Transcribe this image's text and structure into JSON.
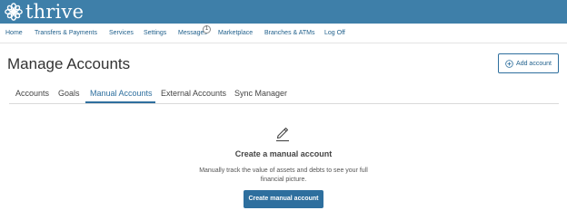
{
  "brand": {
    "name": "thrive",
    "logo_icon": "flower-mark-icon"
  },
  "nav": {
    "items": [
      {
        "label": "Home"
      },
      {
        "label": "Transfers & Payments"
      },
      {
        "label": "Services"
      },
      {
        "label": "Settings"
      },
      {
        "label": "Messages"
      },
      {
        "label": "Marketplace"
      },
      {
        "label": "Branches & ATMs"
      },
      {
        "label": "Log Off"
      }
    ],
    "messages_badge": "1"
  },
  "page": {
    "title": "Manage Accounts",
    "add_button_label": "Add account",
    "add_button_icon": "plus-circle-icon"
  },
  "tabs": {
    "items": [
      {
        "label": "Accounts"
      },
      {
        "label": "Goals"
      },
      {
        "label": "Manual Accounts"
      },
      {
        "label": "External Accounts"
      },
      {
        "label": "Sync Manager"
      }
    ],
    "active": "Manual Accounts"
  },
  "empty_state": {
    "icon": "pencil-icon",
    "title": "Create a manual account",
    "description": "Manually track the value of assets and debts to see your full financial picture.",
    "button_label": "Create manual account"
  },
  "colors": {
    "header": "#3e7fa9",
    "accent": "#2e6f9e",
    "link": "#1f5f8b"
  }
}
